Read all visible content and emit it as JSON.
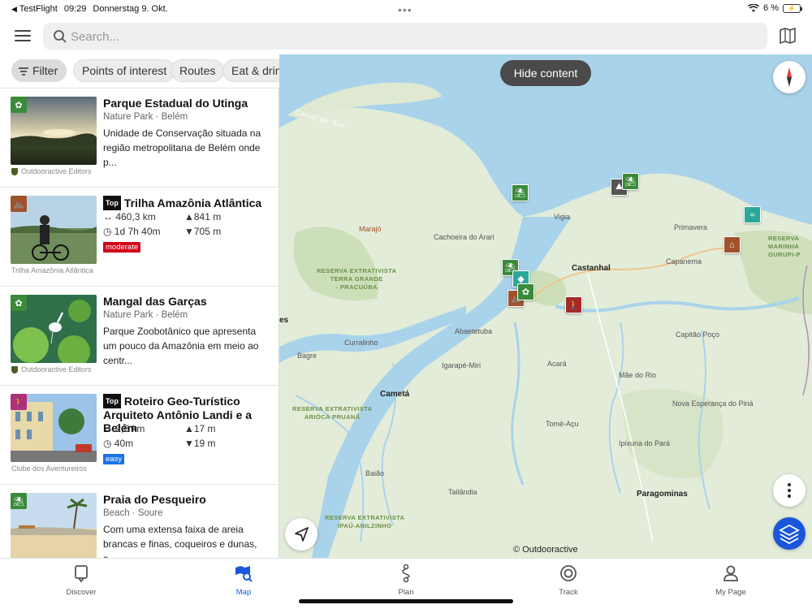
{
  "status_bar": {
    "back_app": "TestFlight",
    "time": "09:29",
    "date": "Donnerstag 9. Okt.",
    "battery": "6 %"
  },
  "search": {
    "placeholder": "Search..."
  },
  "chips": [
    "Filter",
    "Points of interest",
    "Routes",
    "Eat & drink"
  ],
  "list": [
    {
      "title": "Parque Estadual do Utinga",
      "subtitle": "Nature Park · Belém",
      "desc": "Unidade de Conservação situada na região metropolitana de Belém onde p...",
      "source": "Outdooractive Editors",
      "icon": "nature-park-icon",
      "color": "#3a8a3a"
    },
    {
      "top": "Top",
      "title": "Trilha Amazônia Atlântica",
      "distance": "↔ 460,3 km",
      "ascent": "▲841 m",
      "duration": "◷ 1d 7h 40m",
      "descent": "▼705 m",
      "difficulty": "moderate",
      "difficulty_color": "#d0021b",
      "source": "Trilha Amazônia Atlântica",
      "icon": "bike-icon",
      "color": "#a0522d"
    },
    {
      "title": "Mangal das Garças",
      "subtitle": "Nature Park · Belém",
      "desc": "Parque Zoobotânico que apresenta um pouco da Amazônia em meio ao centr...",
      "source": "Outdooractive Editors",
      "icon": "nature-park-icon",
      "color": "#3a8a3a"
    },
    {
      "top": "Top",
      "title": "Roteiro Geo-Turístico Arquiteto Antônio Landi e a Belém",
      "distance": "↔ 2,6 km",
      "ascent": "▲17 m",
      "duration": "◷ 40m",
      "descent": "▼19 m",
      "difficulty": "easy",
      "difficulty_color": "#1a73e8",
      "source": "Clube dos Aventureiros",
      "icon": "hike-icon",
      "color": "#b0307a"
    },
    {
      "title": "Praia do Pesqueiro",
      "subtitle": "Beach · Soure",
      "desc": "Com uma extensa faixa de areia brancas e finas, coqueiros e dunas, a...",
      "source": "",
      "icon": "beach-icon",
      "color": "#3a8a3a"
    }
  ],
  "map": {
    "hide_button": "Hide content",
    "attribution": "© Outdooractive",
    "labels": {
      "canal": "Canal do Sul",
      "marajo": "Marajó",
      "cachoeira": "Cachoeira do Arari",
      "vigia": "Vigia",
      "primavera": "Primavera",
      "castanhal": "Castanhal",
      "capanema": "Capanema",
      "abaetetuba": "Abaetetuba",
      "curralinho": "Curralinho",
      "bagre": "Bagre",
      "igarape": "Igarapé-Miri",
      "acara": "Acará",
      "capitao": "Capitão Poço",
      "maedorio": "Mãe do Rio",
      "cameta": "Cametá",
      "novaesperanca": "Nova Esperança do Piriá",
      "tomeacu": "Tomé-Açu",
      "ipixuna": "Ipixuna do Pará",
      "baiao": "Baião",
      "paragominas": "Paragominas",
      "tailandia": "Tailândia",
      "es": "es",
      "res1": "RESERVA EXTRATIVISTA\nTERRA GRANDE\n- PRACUÚBA",
      "res2": "RESERVA EXTRATIVISTA\nARIÓCA PRUANÃ",
      "res3": "RESERVA EXTRATIVISTA\nIPAÚ-ANILZINHO",
      "res4": "RESERVA\nMARINHA\nGURUPI-P"
    }
  },
  "nav": [
    {
      "label": "Discover",
      "icon": "discover-icon"
    },
    {
      "label": "Map",
      "icon": "map-icon",
      "active": true
    },
    {
      "label": "Plan",
      "icon": "plan-icon"
    },
    {
      "label": "Track",
      "icon": "track-icon"
    },
    {
      "label": "My Page",
      "icon": "my-page-icon"
    }
  ],
  "colors": {
    "accent": "#1a56db",
    "water": "#a9d3ea",
    "land": "#dde9d2"
  }
}
